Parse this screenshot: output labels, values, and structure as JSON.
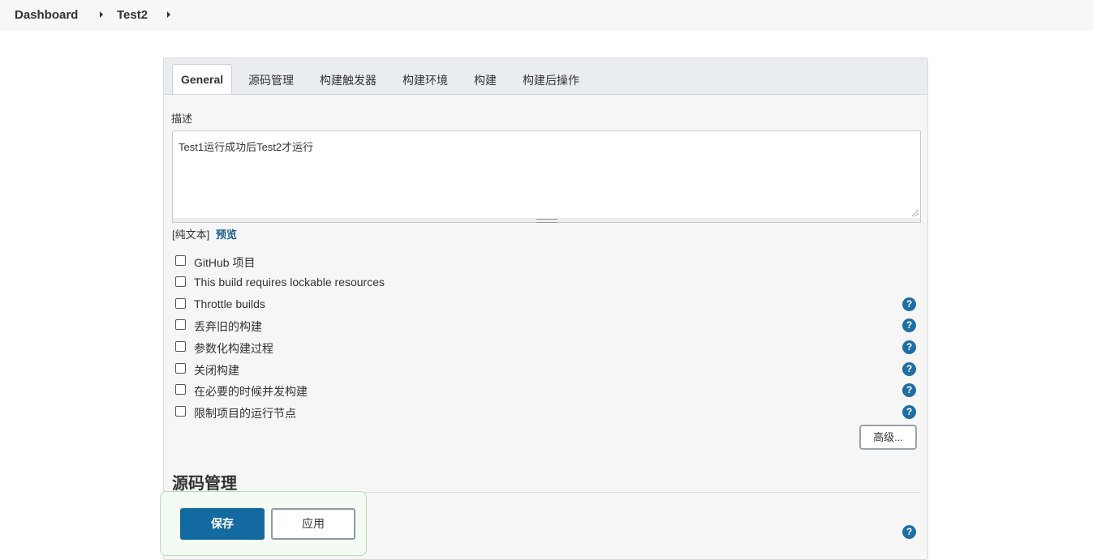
{
  "breadcrumb": {
    "items": [
      "Dashboard",
      "Test2"
    ]
  },
  "tabs": [
    {
      "label": "General",
      "active": true
    },
    {
      "label": "源码管理",
      "active": false
    },
    {
      "label": "构建触发器",
      "active": false
    },
    {
      "label": "构建环境",
      "active": false
    },
    {
      "label": "构建",
      "active": false
    },
    {
      "label": "构建后操作",
      "active": false
    }
  ],
  "general": {
    "description_label": "描述",
    "description_value": "Test1运行成功后Test2才运行",
    "plain_text_note": "[纯文本]",
    "preview_link": "预览",
    "options": [
      {
        "label": "GitHub 项目",
        "checked": false,
        "help": false
      },
      {
        "label": "This build requires lockable resources",
        "checked": false,
        "help": false
      },
      {
        "label": "Throttle builds",
        "checked": false,
        "help": true
      },
      {
        "label": "丢弃旧的构建",
        "checked": false,
        "help": true
      },
      {
        "label": "参数化构建过程",
        "checked": false,
        "help": true
      },
      {
        "label": "关闭构建",
        "checked": false,
        "help": true
      },
      {
        "label": "在必要的时候并发构建",
        "checked": false,
        "help": true
      },
      {
        "label": "限制项目的运行节点",
        "checked": false,
        "help": true
      }
    ],
    "help_symbol": "?",
    "advanced_button": "高级..."
  },
  "scm": {
    "heading": "源码管理"
  },
  "actions": {
    "save": "保存",
    "apply": "应用"
  },
  "colors": {
    "accent": "#136aa0",
    "help_icon": "#1f6ea4",
    "link": "#1b5c8e"
  }
}
